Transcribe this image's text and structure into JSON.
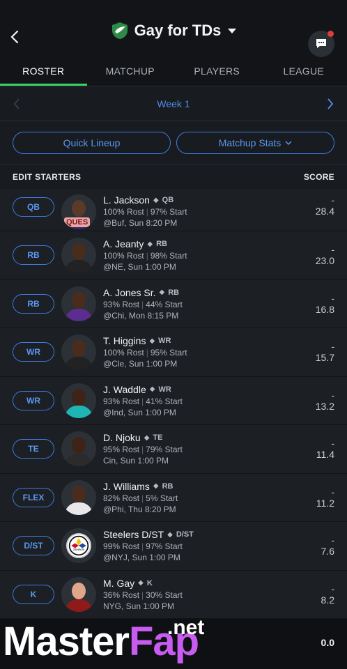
{
  "header": {
    "team_name": "Gay for TDs"
  },
  "tabs": [
    {
      "label": "ROSTER",
      "active": true
    },
    {
      "label": "MATCHUP",
      "active": false
    },
    {
      "label": "PLAYERS",
      "active": false
    },
    {
      "label": "LEAGUE",
      "active": false
    }
  ],
  "week": {
    "label": "Week 1"
  },
  "buttons": {
    "quick_lineup": "Quick Lineup",
    "matchup_stats": "Matchup Stats"
  },
  "section": {
    "edit_starters": "EDIT STARTERS",
    "score": "SCORE"
  },
  "players": [
    {
      "slot": "QB",
      "name": "L. Jackson",
      "pos": "QB",
      "rost": "100% Rost",
      "start": "97% Start",
      "game": "@Buf, Sun 8:20 PM",
      "proj": "-",
      "score": "28.4",
      "badge": "QUES",
      "skin": "#5a3a28",
      "jersey": "#3a2a6a"
    },
    {
      "slot": "RB",
      "name": "A. Jeanty",
      "pos": "RB",
      "rost": "100% Rost",
      "start": "98% Start",
      "game": "@NE, Sun 1:00 PM",
      "proj": "-",
      "score": "23.0",
      "skin": "#4a2c1c",
      "jersey": "#222222"
    },
    {
      "slot": "RB",
      "name": "A. Jones Sr.",
      "pos": "RB",
      "rost": "93% Rost",
      "start": "44% Start",
      "game": "@Chi, Mon 8:15 PM",
      "proj": "-",
      "score": "16.8",
      "skin": "#4a2c1c",
      "jersey": "#5b2d8e"
    },
    {
      "slot": "WR",
      "name": "T. Higgins",
      "pos": "WR",
      "rost": "100% Rost",
      "start": "95% Start",
      "game": "@Cle, Sun 1:00 PM",
      "proj": "-",
      "score": "15.7",
      "skin": "#4a2c1c",
      "jersey": "#222222"
    },
    {
      "slot": "WR",
      "name": "J. Waddle",
      "pos": "WR",
      "rost": "93% Rost",
      "start": "41% Start",
      "game": "@Ind, Sun 1:00 PM",
      "proj": "-",
      "score": "13.2",
      "skin": "#3e2416",
      "jersey": "#1fb5b5"
    },
    {
      "slot": "TE",
      "name": "D. Njoku",
      "pos": "TE",
      "rost": "95% Rost",
      "start": "79% Start",
      "game": "Cin, Sun 1:00 PM",
      "proj": "-",
      "score": "11.4",
      "skin": "#3e2416",
      "jersey": "#2b2b2b"
    },
    {
      "slot": "FLEX",
      "name": "J. Williams",
      "pos": "RB",
      "rost": "82% Rost",
      "start": "5% Start",
      "game": "@Phi, Thu 8:20 PM",
      "proj": "-",
      "score": "11.2",
      "skin": "#4a2c1c",
      "jersey": "#e8e8e8"
    },
    {
      "slot": "D/ST",
      "name": "Steelers D/ST",
      "pos": "D/ST",
      "rost": "99% Rost",
      "start": "97% Start",
      "game": "@NYJ, Sun 1:00 PM",
      "proj": "-",
      "score": "7.6",
      "logo": true
    },
    {
      "slot": "K",
      "name": "M. Gay",
      "pos": "K",
      "rost": "36% Rost",
      "start": "30% Start",
      "game": "NYG, Sun 1:00 PM",
      "proj": "-",
      "score": "8.2",
      "skin": "#e0a58a",
      "jersey": "#8e1a1a"
    }
  ],
  "footer": {
    "total": "0.0"
  },
  "watermark": {
    "part1": "Master",
    "part2": "Fap",
    "suffix": ".net"
  }
}
